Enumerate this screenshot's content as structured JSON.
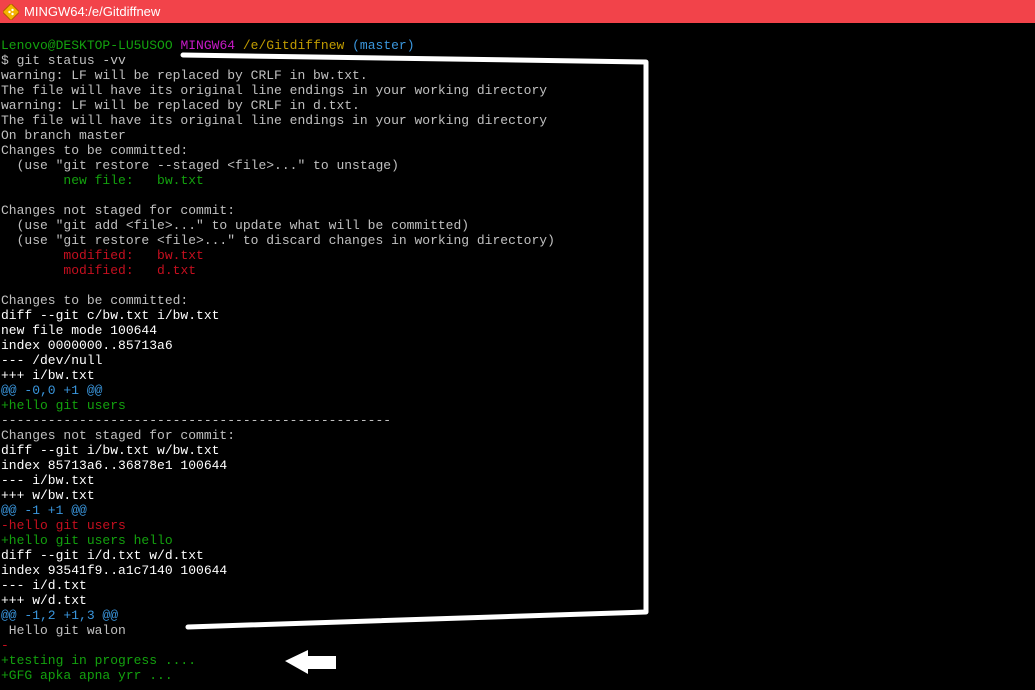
{
  "window": {
    "title": "MINGW64:/e/Gitdiffnew"
  },
  "colors": {
    "title_bar": "#f2434a",
    "default_text": "#c0c0c0",
    "green": "#13a10e",
    "red": "#c50f1f",
    "cyan": "#3a96dd",
    "magenta": "#c71ac7",
    "yellow": "#c19c00",
    "white": "#ffffff"
  },
  "lines": [
    [
      {
        "t": "Lenovo@DESKTOP-LU5USOO",
        "c": "green"
      },
      {
        "t": " ",
        "c": "default"
      },
      {
        "t": "MINGW64",
        "c": "magenta"
      },
      {
        "t": " ",
        "c": "default"
      },
      {
        "t": "/e/Gitdiffnew",
        "c": "yellow"
      },
      {
        "t": " ",
        "c": "default"
      },
      {
        "t": "(master)",
        "c": "cyan"
      }
    ],
    [
      {
        "t": "$ git status -vv",
        "c": "default"
      }
    ],
    [
      {
        "t": "warning: LF will be replaced by CRLF in bw.txt.",
        "c": "default"
      }
    ],
    [
      {
        "t": "The file will have its original line endings in your working directory",
        "c": "default"
      }
    ],
    [
      {
        "t": "warning: LF will be replaced by CRLF in d.txt.",
        "c": "default"
      }
    ],
    [
      {
        "t": "The file will have its original line endings in your working directory",
        "c": "default"
      }
    ],
    [
      {
        "t": "On branch master",
        "c": "default"
      }
    ],
    [
      {
        "t": "Changes to be committed:",
        "c": "default"
      }
    ],
    [
      {
        "t": "  (use \"git restore --staged <file>...\" to unstage)",
        "c": "default"
      }
    ],
    [
      {
        "t": "        ",
        "c": "default"
      },
      {
        "t": "new file:   bw.txt",
        "c": "green"
      }
    ],
    [
      {
        "t": "",
        "c": "default"
      }
    ],
    [
      {
        "t": "Changes not staged for commit:",
        "c": "default"
      }
    ],
    [
      {
        "t": "  (use \"git add <file>...\" to update what will be committed)",
        "c": "default"
      }
    ],
    [
      {
        "t": "  (use \"git restore <file>...\" to discard changes in working directory)",
        "c": "default"
      }
    ],
    [
      {
        "t": "        ",
        "c": "default"
      },
      {
        "t": "modified:   bw.txt",
        "c": "red"
      }
    ],
    [
      {
        "t": "        ",
        "c": "default"
      },
      {
        "t": "modified:   d.txt",
        "c": "red"
      }
    ],
    [
      {
        "t": "",
        "c": "default"
      }
    ],
    [
      {
        "t": "Changes to be committed:",
        "c": "default"
      }
    ],
    [
      {
        "t": "diff --git c/bw.txt i/bw.txt",
        "c": "white"
      }
    ],
    [
      {
        "t": "new file mode 100644",
        "c": "white"
      }
    ],
    [
      {
        "t": "index 0000000..85713a6",
        "c": "white"
      }
    ],
    [
      {
        "t": "--- /dev/null",
        "c": "white"
      }
    ],
    [
      {
        "t": "+++ i/bw.txt",
        "c": "white"
      }
    ],
    [
      {
        "t": "@@ -0,0 +1 @@",
        "c": "cyan"
      }
    ],
    [
      {
        "t": "+hello git users",
        "c": "green"
      }
    ],
    [
      {
        "t": "--------------------------------------------------",
        "c": "default"
      }
    ],
    [
      {
        "t": "Changes not staged for commit:",
        "c": "default"
      }
    ],
    [
      {
        "t": "diff --git i/bw.txt w/bw.txt",
        "c": "white"
      }
    ],
    [
      {
        "t": "index 85713a6..36878e1 100644",
        "c": "white"
      }
    ],
    [
      {
        "t": "--- i/bw.txt",
        "c": "white"
      }
    ],
    [
      {
        "t": "+++ w/bw.txt",
        "c": "white"
      }
    ],
    [
      {
        "t": "@@ -1 +1 @@",
        "c": "cyan"
      }
    ],
    [
      {
        "t": "-hello git users",
        "c": "red"
      }
    ],
    [
      {
        "t": "+hello git users hello",
        "c": "green"
      }
    ],
    [
      {
        "t": "diff --git i/d.txt w/d.txt",
        "c": "white"
      }
    ],
    [
      {
        "t": "index 93541f9..a1c7140 100644",
        "c": "white"
      }
    ],
    [
      {
        "t": "--- i/d.txt",
        "c": "white"
      }
    ],
    [
      {
        "t": "+++ w/d.txt",
        "c": "white"
      }
    ],
    [
      {
        "t": "@@ -1,2 +1,3 @@",
        "c": "cyan"
      }
    ],
    [
      {
        "t": " Hello git walon",
        "c": "default"
      }
    ],
    [
      {
        "t": "-",
        "c": "red"
      }
    ],
    [
      {
        "t": "+testing in progress ....",
        "c": "green"
      }
    ],
    [
      {
        "t": "+GFG apka apna yrr ...",
        "c": "green"
      }
    ]
  ]
}
